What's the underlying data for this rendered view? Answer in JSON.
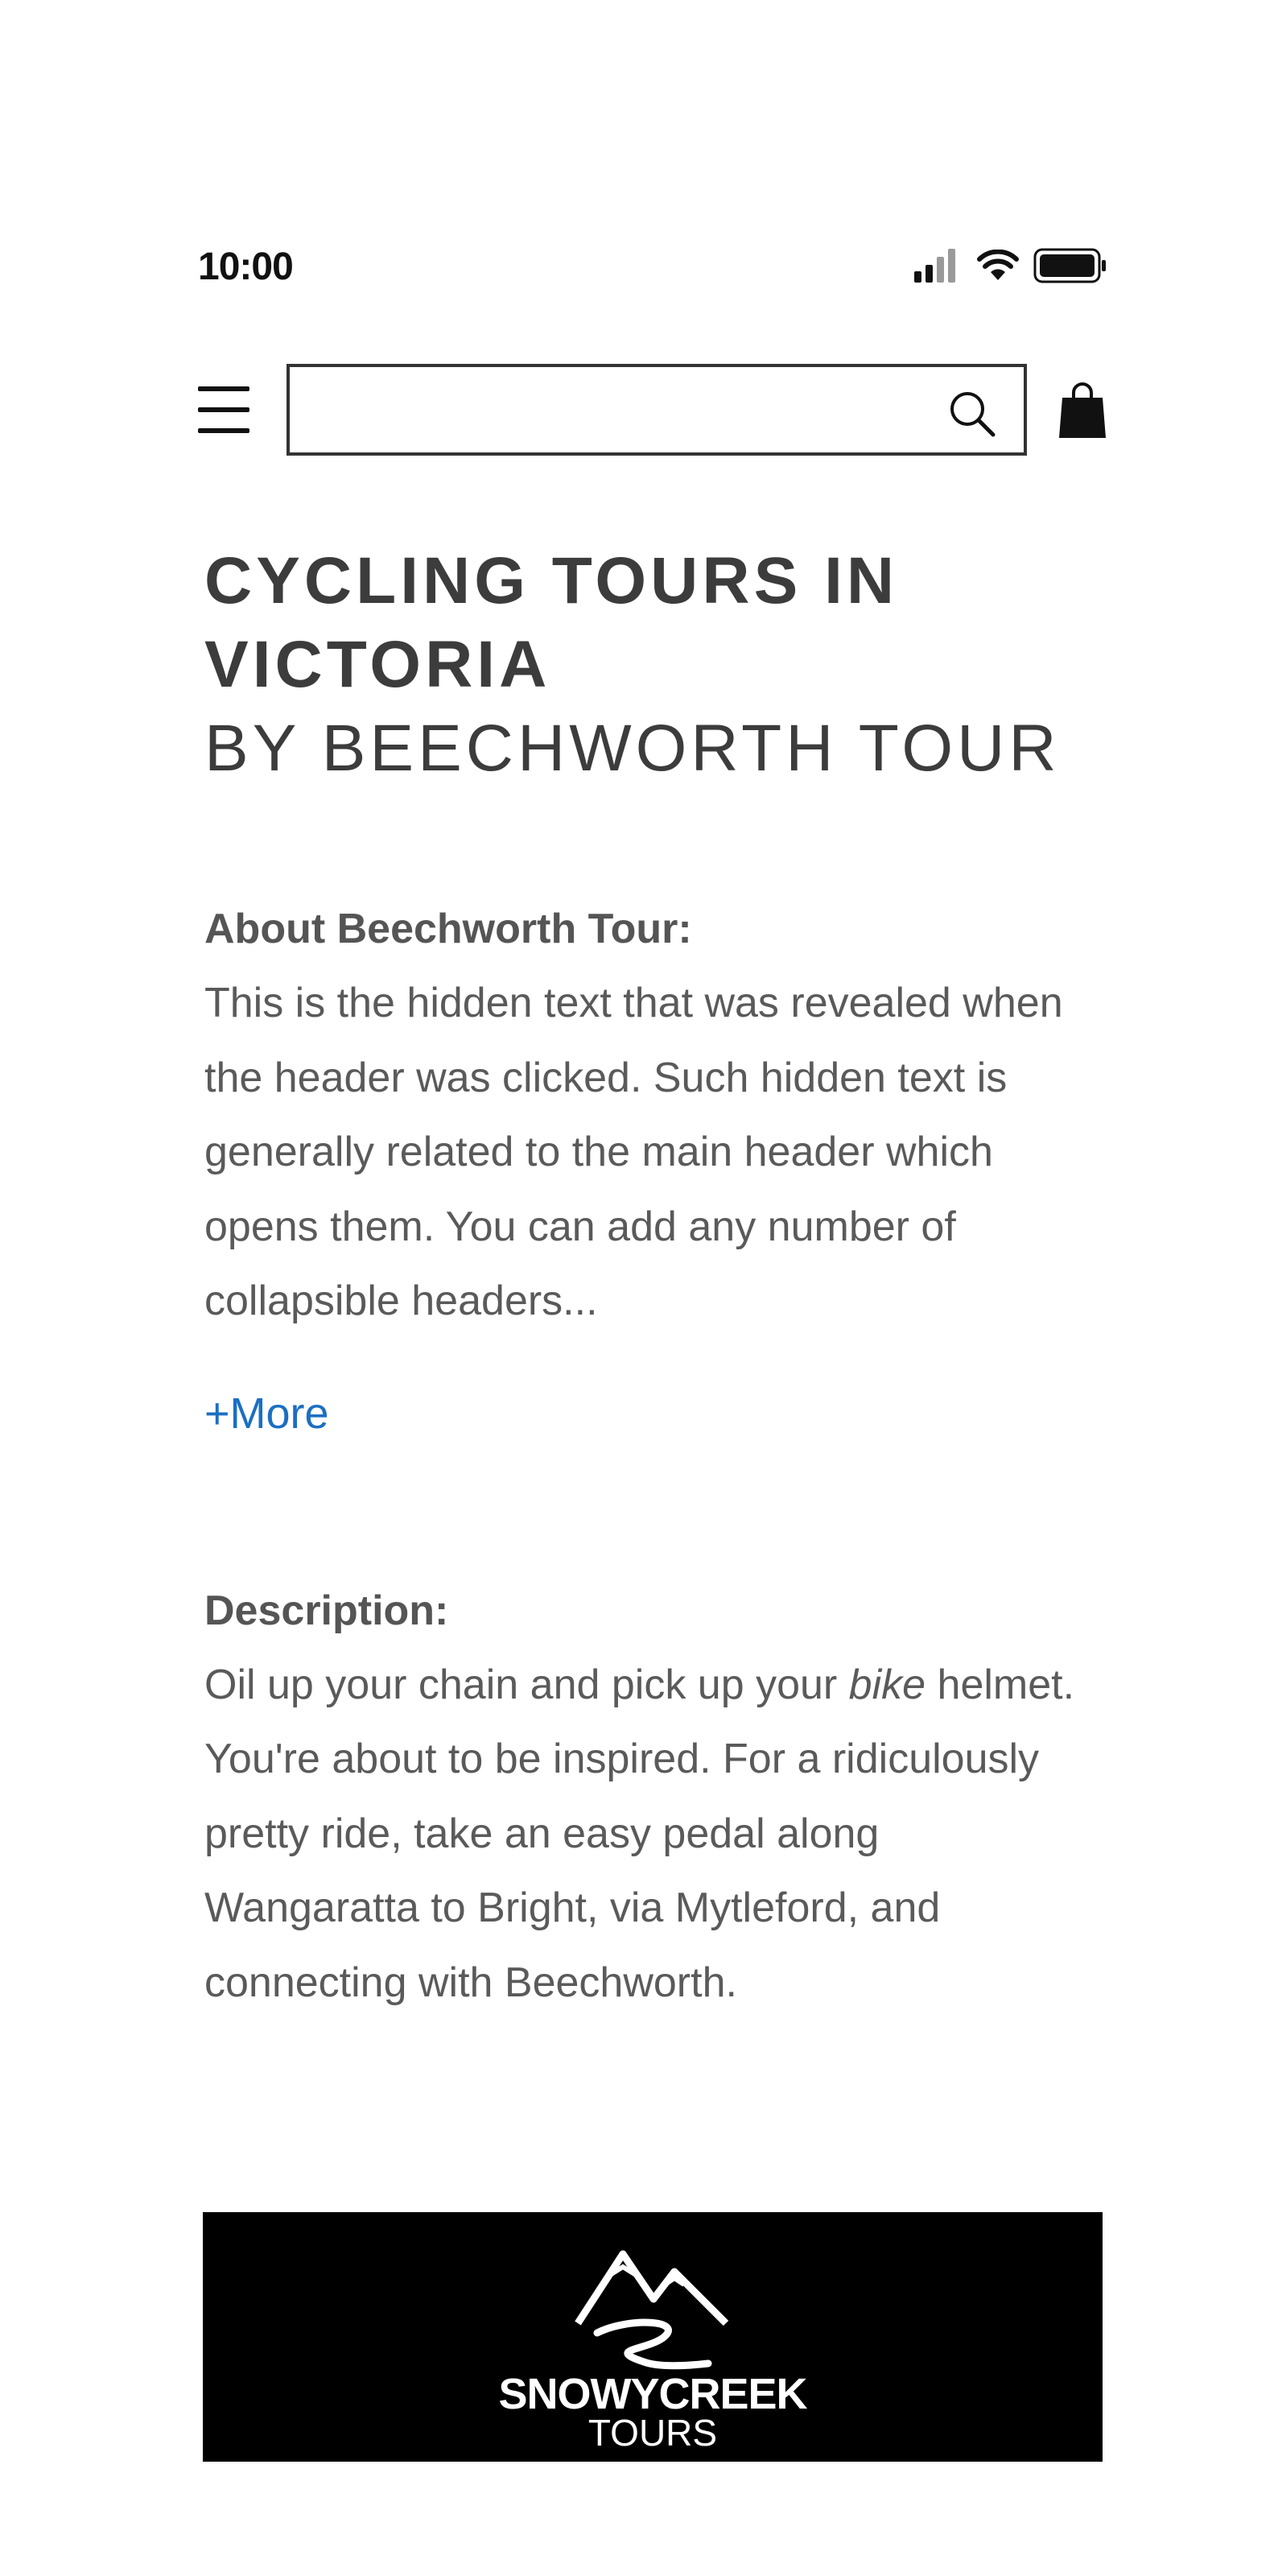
{
  "status_bar": {
    "time": "10:00"
  },
  "header": {
    "search_placeholder": "",
    "menu_icon": "hamburger-menu-icon",
    "search_icon": "magnifier-icon",
    "cart_icon": "shopping-bag-icon"
  },
  "page": {
    "title": "CYCLING TOURS IN VICTORIA",
    "subtitle": "BY BEECHWORTH TOUR"
  },
  "about": {
    "heading": "About Beechworth Tour:",
    "text": "This is the hidden text that was revealed when the header was clicked. Such hidden text is generally related to the main header which opens them. You can add any number of collapsible headers...",
    "more_label": "+More"
  },
  "description": {
    "heading": "Description:",
    "text_before": "Oil up your chain and pick up your ",
    "text_em": "bike",
    "text_after": " helmet. You're about to be inspired. For a ridiculously pretty ride, take an easy pedal along Wangaratta to Bright, via Mytleford, and connecting with Beechworth."
  },
  "footer_logo": {
    "name": "SNOWYCREEK",
    "sub": "TOURS"
  },
  "colors": {
    "link": "#1b6fc2",
    "text": "#5a5a5a",
    "banner": "#000000"
  }
}
